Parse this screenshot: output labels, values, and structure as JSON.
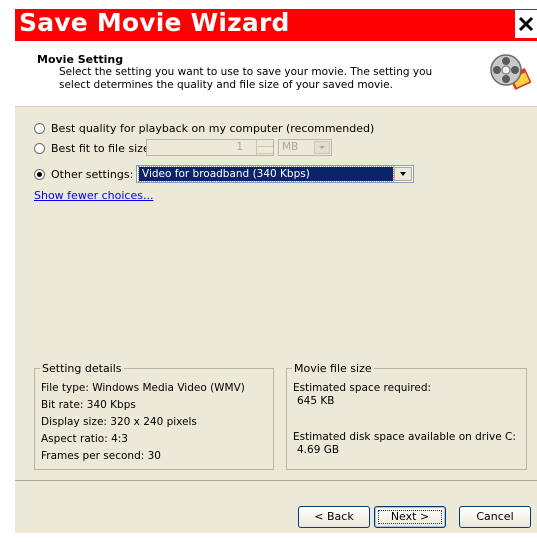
{
  "window": {
    "title": "Save Movie Wizard",
    "close_glyph": "✕"
  },
  "header": {
    "title": "Movie Setting",
    "description": "Select the setting you want to use to save your movie. The setting you select determines the quality and file size of your saved movie.",
    "icon": "windows-movie-maker-film-reel-icon"
  },
  "options": {
    "best_quality_label": "Best quality for playback on my computer (recommended)",
    "best_fit_label": "Best fit to file size:",
    "file_size_value": "1",
    "file_size_unit": "MB",
    "other_settings_label": "Other settings:",
    "other_settings_value": "Video for broadband (340 Kbps)",
    "selected_option": "other_settings",
    "show_fewer_link": "Show fewer choices..."
  },
  "setting_details": {
    "legend": "Setting details",
    "file_type": "File type: Windows Media Video (WMV)",
    "bit_rate": "Bit rate: 340 Kbps",
    "display_size": "Display size: 320 x 240 pixels",
    "aspect_ratio": "Aspect ratio: 4:3",
    "fps": "Frames per second: 30"
  },
  "movie_file_size": {
    "legend": "Movie file size",
    "est_space_label": "Estimated space required:",
    "est_space_value": "645 KB",
    "disk_space_label": "Estimated disk space available on drive C:",
    "disk_space_value": "4.69 GB"
  },
  "buttons": {
    "back": "< Back",
    "next": "Next >",
    "cancel": "Cancel"
  },
  "colors": {
    "title_bar": "#ff0000",
    "dialog_bg": "#ece9d8",
    "selection": "#0a246a",
    "link": "#0000ff"
  }
}
